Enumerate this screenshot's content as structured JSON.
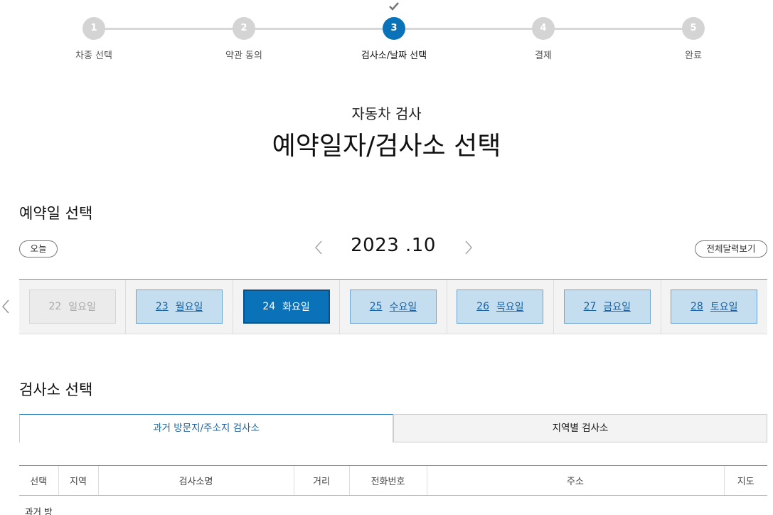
{
  "stepper": {
    "steps": [
      {
        "num": "1",
        "label": "차종 선택"
      },
      {
        "num": "2",
        "label": "약관 동의"
      },
      {
        "num": "3",
        "label": "검사소/날짜 선택"
      },
      {
        "num": "4",
        "label": "결제"
      },
      {
        "num": "5",
        "label": "완료"
      }
    ],
    "active_step": 3
  },
  "heading": {
    "sub_title": "자동차 검사",
    "main_title": "예약일자/검사소 선택"
  },
  "date_section": {
    "title": "예약일 선택",
    "today_button": "오늘",
    "month_label": "2023 .10",
    "full_calendar_button": "전체달력보기",
    "days": [
      {
        "day": "22",
        "weekday": "일요일",
        "state": "disabled"
      },
      {
        "day": "23",
        "weekday": "월요일",
        "state": "available"
      },
      {
        "day": "24",
        "weekday": "화요일",
        "state": "selected"
      },
      {
        "day": "25",
        "weekday": "수요일",
        "state": "available"
      },
      {
        "day": "26",
        "weekday": "목요일",
        "state": "available"
      },
      {
        "day": "27",
        "weekday": "금요일",
        "state": "available"
      },
      {
        "day": "28",
        "weekday": "토요일",
        "state": "available"
      }
    ]
  },
  "center_section": {
    "title": "검사소 선택",
    "tabs": [
      {
        "label": "과거 방문지/주소지 검사소",
        "active": true
      },
      {
        "label": "지역별 검사소",
        "active": false
      }
    ],
    "table_headers": [
      "선택",
      "지역",
      "검사소명",
      "거리",
      "전화번호",
      "주소",
      "지도"
    ],
    "row_note": "과거 방"
  },
  "colors": {
    "accent": "#0a72b8",
    "day_available_bg": "#c4def0",
    "day_disabled_bg": "#ebebeb",
    "step_inactive": "#d4d4d4"
  }
}
